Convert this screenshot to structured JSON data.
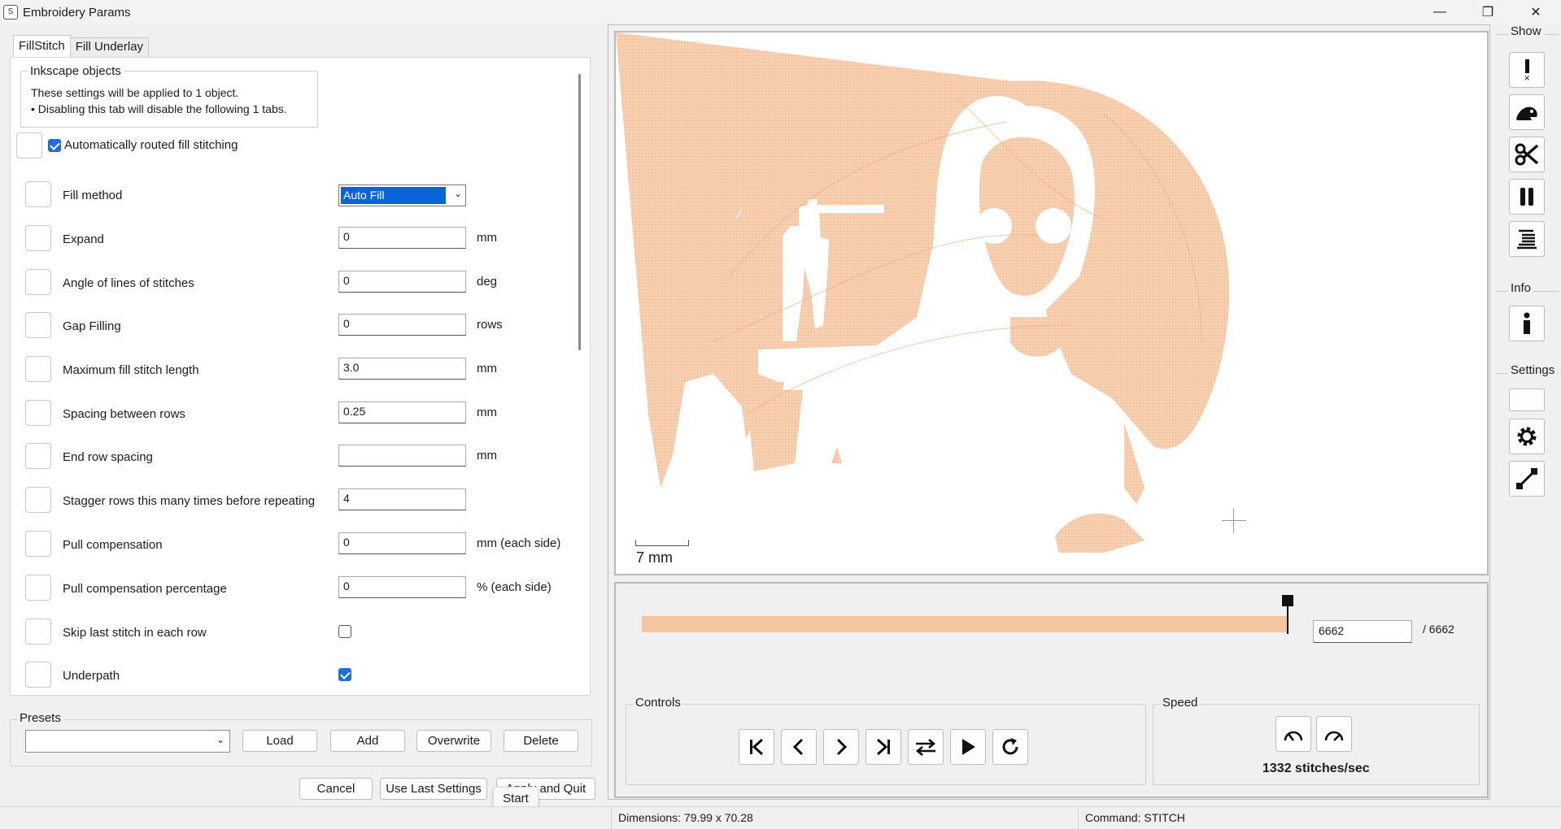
{
  "window": {
    "title": "Embroidery Params",
    "icon_text": "S",
    "minimize": "—",
    "restore": "❐",
    "close": "✕"
  },
  "tabs": [
    {
      "label": "FillStitch",
      "active": true
    },
    {
      "label": "Fill Underlay",
      "active": false
    }
  ],
  "info_group": {
    "legend": "Inkscape objects",
    "line1": "These settings will be applied to 1 object.",
    "line2": "• Disabling this tab will disable the following 1 tabs."
  },
  "auto_route": {
    "label": "Automatically routed fill stitching",
    "checked": true
  },
  "params": {
    "fill_method": {
      "label": "Fill method",
      "value": "Auto Fill"
    },
    "expand": {
      "label": "Expand",
      "value": "0",
      "unit": "mm"
    },
    "angle": {
      "label": "Angle of lines of stitches",
      "value": "0",
      "unit": "deg"
    },
    "gap": {
      "label": "Gap Filling",
      "value": "0",
      "unit": "rows"
    },
    "max_len": {
      "label": "Maximum fill stitch length",
      "value": "3.0",
      "unit": "mm"
    },
    "spacing": {
      "label": "Spacing between rows",
      "value": "0.25",
      "unit": "mm"
    },
    "end_row": {
      "label": "End row spacing",
      "value": "",
      "unit": "mm"
    },
    "stagger": {
      "label": "Stagger rows this many times before repeating",
      "value": "4"
    },
    "pull_comp": {
      "label": "Pull compensation",
      "value": "0",
      "unit": "mm (each side)"
    },
    "pull_pct": {
      "label": "Pull compensation percentage",
      "value": "0",
      "unit": "% (each side)"
    },
    "skip_last": {
      "label": "Skip last stitch in each row",
      "checked": false
    },
    "underpath": {
      "label": "Underpath",
      "checked": true
    }
  },
  "presets": {
    "legend": "Presets",
    "selected": "",
    "load": "Load",
    "add": "Add",
    "overwrite": "Overwrite",
    "delete": "Delete"
  },
  "footer": {
    "cancel": "Cancel",
    "use_last": "Use Last Settings",
    "apply_quit": "Apply and Quit",
    "tooltip": "Start"
  },
  "preview": {
    "scale_label": "7 mm",
    "stitch_current": "6662",
    "stitch_total": "/ 6662",
    "progress_fraction": 1.0
  },
  "controls": {
    "legend": "Controls"
  },
  "speed": {
    "legend": "Speed",
    "text": "1332 stitches/sec"
  },
  "sidebar": {
    "show": "Show",
    "info": "Info",
    "settings": "Settings"
  },
  "status": {
    "dimensions": "Dimensions: 79.99 x 70.28",
    "command": "Command: STITCH"
  },
  "colors": {
    "accent": "#1f6ed4",
    "stitch_fill": "#f5c59f",
    "stitch_line": "#e8a67a"
  }
}
